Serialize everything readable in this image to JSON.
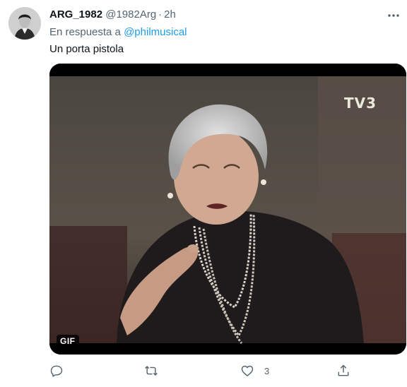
{
  "author": {
    "display_name": "ARG_1982",
    "handle": "@1982Arg",
    "separator": "·",
    "time": "2h",
    "avatar_icon": "profile-photo"
  },
  "reply_context": {
    "prefix": "En respuesta a",
    "mention": "@philmusical"
  },
  "text": "Un porta pistola",
  "media": {
    "badge": "GIF",
    "watermark": "TV3"
  },
  "actions": {
    "reply": {
      "icon": "reply-icon",
      "count": ""
    },
    "retweet": {
      "icon": "retweet-icon",
      "count": ""
    },
    "like": {
      "icon": "heart-icon",
      "count": "3"
    },
    "share": {
      "icon": "share-icon",
      "count": ""
    }
  },
  "colors": {
    "link": "#1d9bf0",
    "secondary_text": "#536471",
    "primary_text": "#0f1419"
  }
}
